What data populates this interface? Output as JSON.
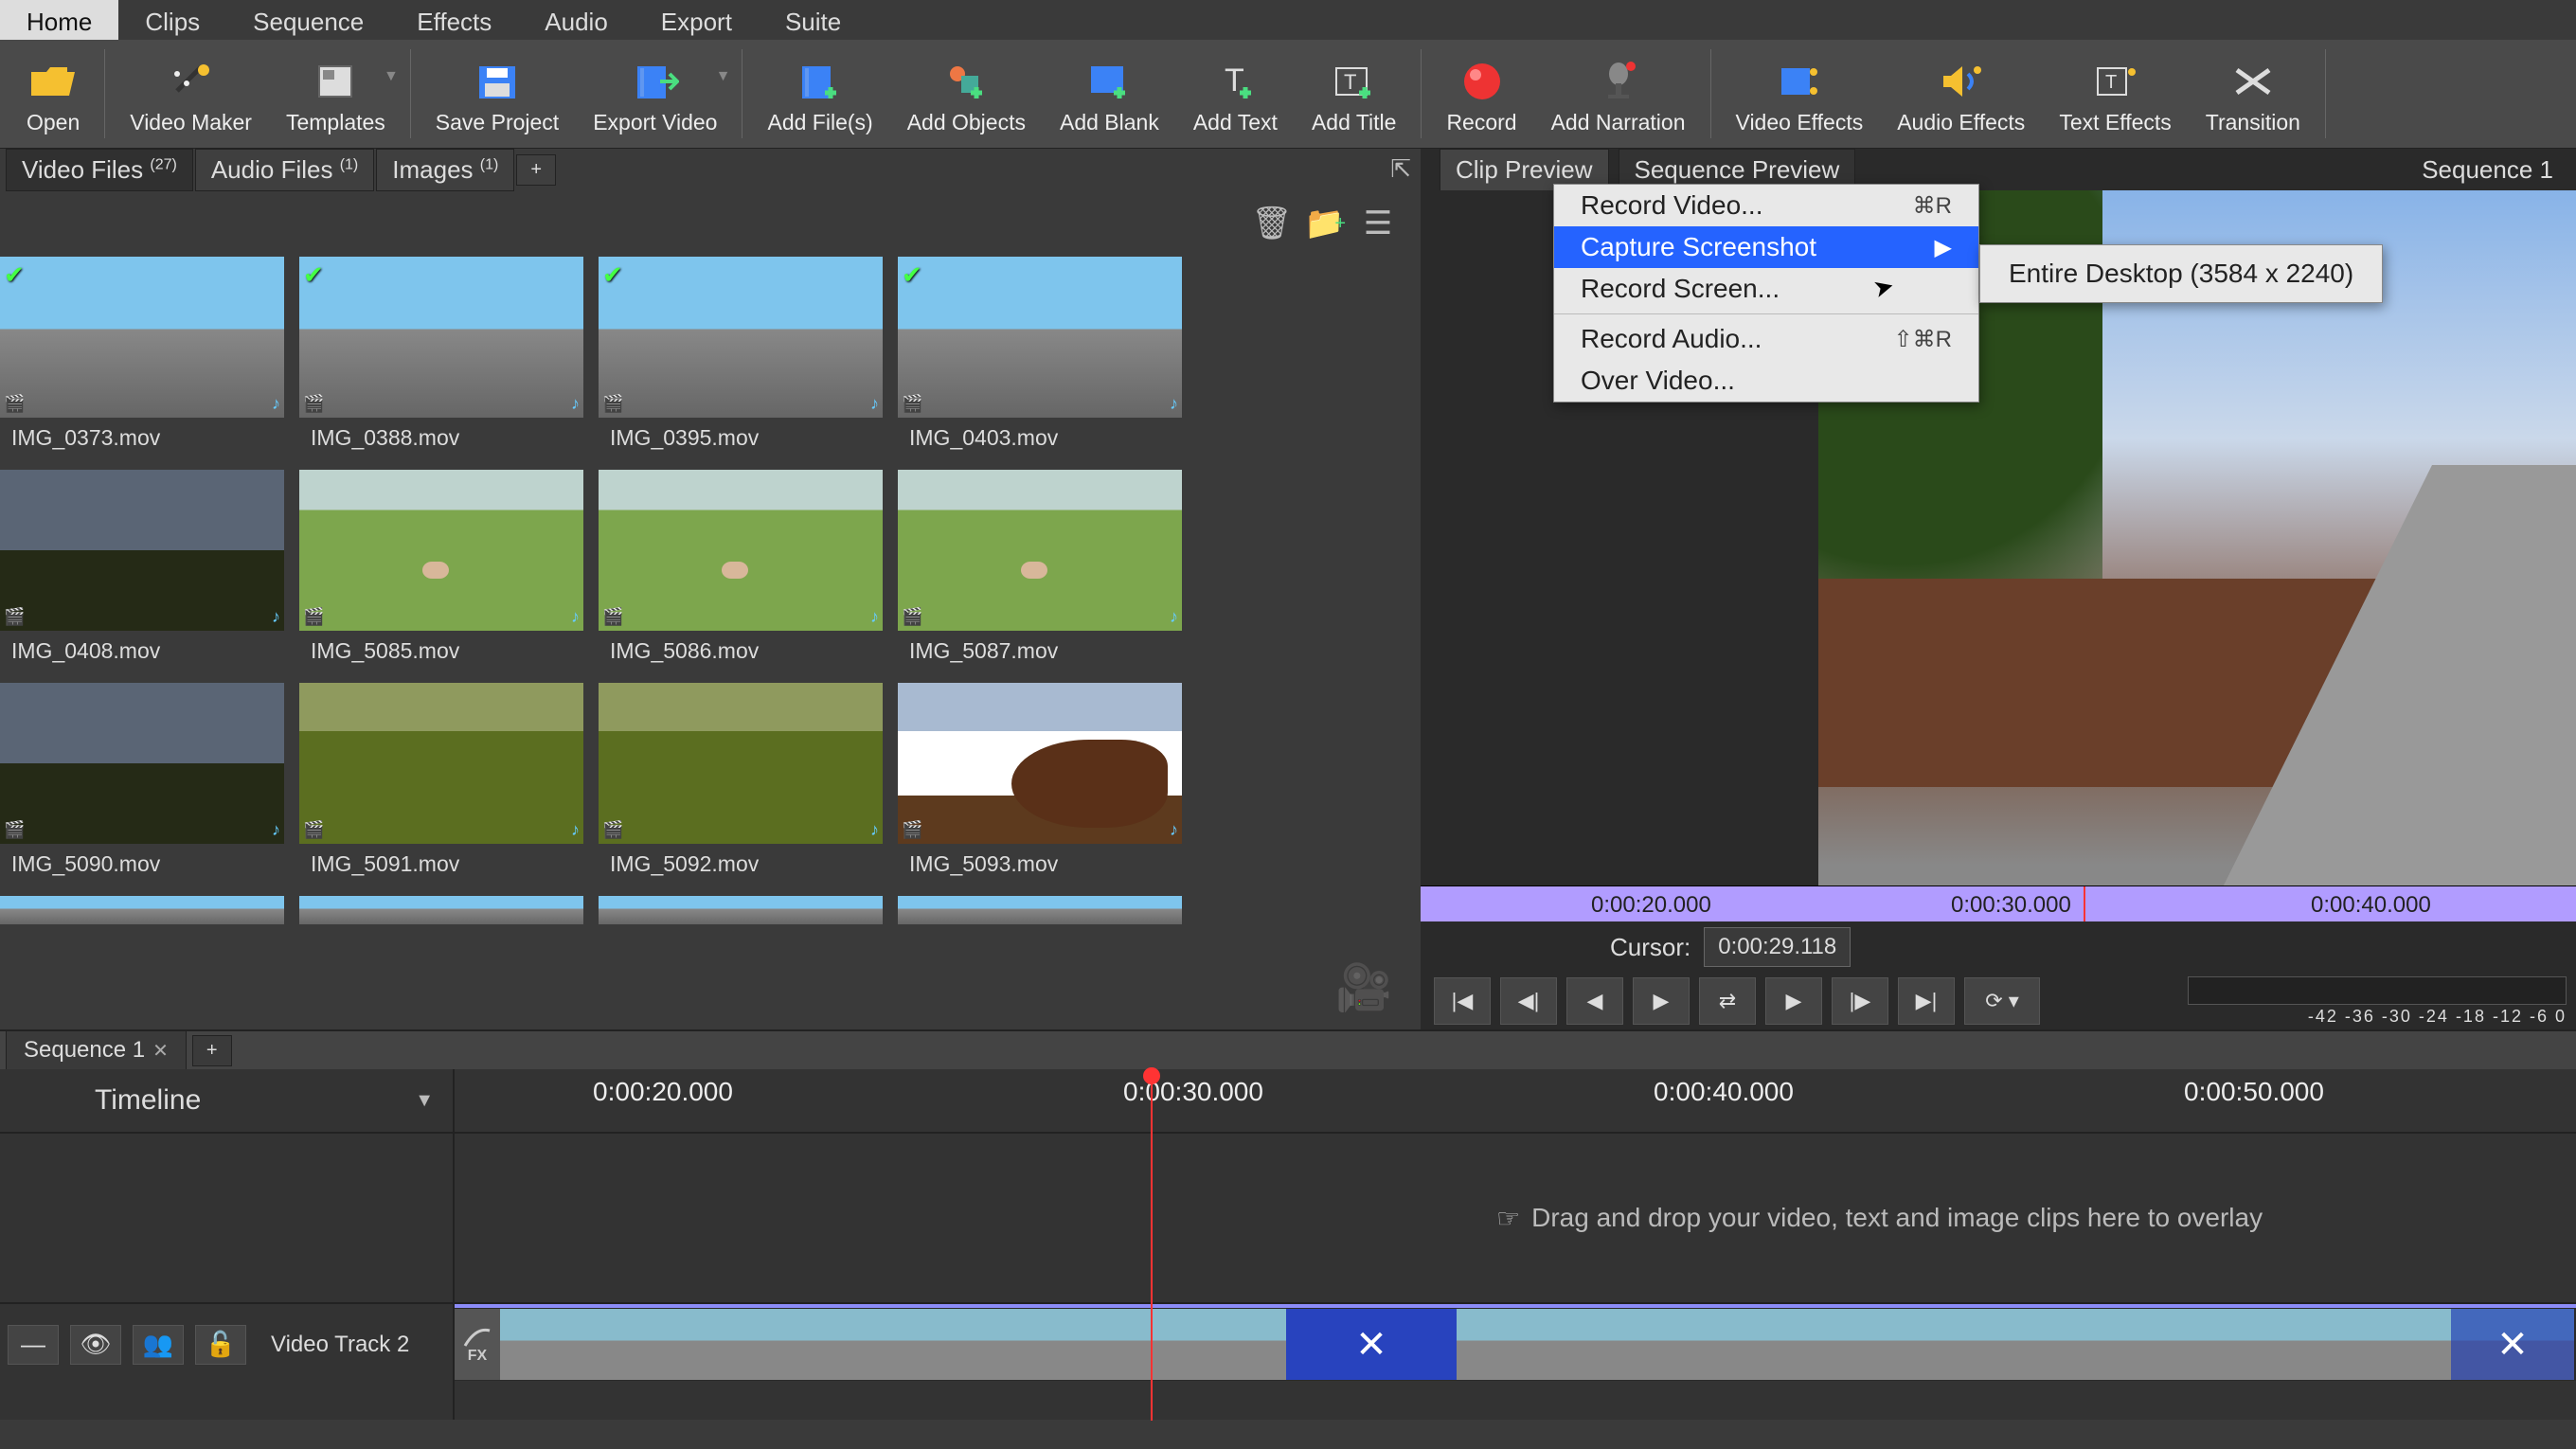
{
  "main_menu": {
    "items": [
      "Home",
      "Clips",
      "Sequence",
      "Effects",
      "Audio",
      "Export",
      "Suite"
    ],
    "active_index": 0
  },
  "toolbar": [
    {
      "label": "Open"
    },
    {
      "label": "Video Maker"
    },
    {
      "label": "Templates"
    },
    {
      "label": "Save Project"
    },
    {
      "label": "Export Video"
    },
    {
      "label": "Add File(s)"
    },
    {
      "label": "Add Objects"
    },
    {
      "label": "Add Blank"
    },
    {
      "label": "Add Text"
    },
    {
      "label": "Add Title"
    },
    {
      "label": "Record"
    },
    {
      "label": "Add Narration"
    },
    {
      "label": "Video Effects"
    },
    {
      "label": "Audio Effects"
    },
    {
      "label": "Text Effects"
    },
    {
      "label": "Transition"
    }
  ],
  "media_tabs": {
    "items": [
      {
        "label": "Video Files",
        "count": "(27)",
        "active": true
      },
      {
        "label": "Audio Files",
        "count": "(1)",
        "active": false
      },
      {
        "label": "Images",
        "count": "(1)",
        "active": false
      }
    ],
    "add_label": "+"
  },
  "media_files": [
    {
      "caption": "IMG_0373.mov",
      "check": true,
      "kind": "road"
    },
    {
      "caption": "IMG_0388.mov",
      "check": true,
      "kind": "road"
    },
    {
      "caption": "IMG_0395.mov",
      "check": true,
      "kind": "road"
    },
    {
      "caption": "IMG_0403.mov",
      "check": true,
      "kind": "road"
    },
    {
      "caption": "IMG_0408.mov",
      "check": false,
      "kind": "dark"
    },
    {
      "caption": "IMG_5085.mov",
      "check": false,
      "kind": "field"
    },
    {
      "caption": "IMG_5086.mov",
      "check": false,
      "kind": "field"
    },
    {
      "caption": "IMG_5087.mov",
      "check": false,
      "kind": "field"
    },
    {
      "caption": "IMG_5090.mov",
      "check": false,
      "kind": "dark"
    },
    {
      "caption": "IMG_5091.mov",
      "check": false,
      "kind": "olive"
    },
    {
      "caption": "IMG_5092.mov",
      "check": false,
      "kind": "olive"
    },
    {
      "caption": "IMG_5093.mov",
      "check": false,
      "kind": "cow"
    }
  ],
  "preview": {
    "tabs": {
      "clip": "Clip Preview",
      "sequence": "Sequence Preview",
      "sequence_label": "Sequence 1"
    },
    "scrub_labels": [
      "0:00:20.000",
      "0:00:30.000",
      "0:00:40.000"
    ],
    "cursor_label": "Cursor:",
    "cursor_value": "0:00:29.118",
    "vu_labels": "-42 -36 -30 -24 -18 -12  -6   0"
  },
  "context_menu": {
    "items": [
      {
        "label": "Record Video...",
        "shortcut": "⌘R",
        "submenu": false
      },
      {
        "label": "Capture Screenshot",
        "shortcut": "▶",
        "submenu": true,
        "selected": true
      },
      {
        "label": "Record Screen...",
        "shortcut": "",
        "submenu": false
      },
      {
        "divider": true
      },
      {
        "label": "Record Audio...",
        "shortcut": "⇧⌘R",
        "submenu": false
      },
      {
        "label": "Over Video...",
        "shortcut": "",
        "submenu": false
      }
    ],
    "submenu_item": "Entire Desktop (3584 x 2240)"
  },
  "timeline": {
    "tab_label": "Sequence 1",
    "add_label": "+",
    "header_label": "Timeline",
    "ruler_labels": [
      "0:00:20.000",
      "0:00:30.000",
      "0:00:40.000",
      "0:00:50.000"
    ],
    "overlay_hint": "Drag and drop your video, text and image clips here to overlay",
    "track_label": "Video Track 2",
    "fx_label": "FX"
  }
}
